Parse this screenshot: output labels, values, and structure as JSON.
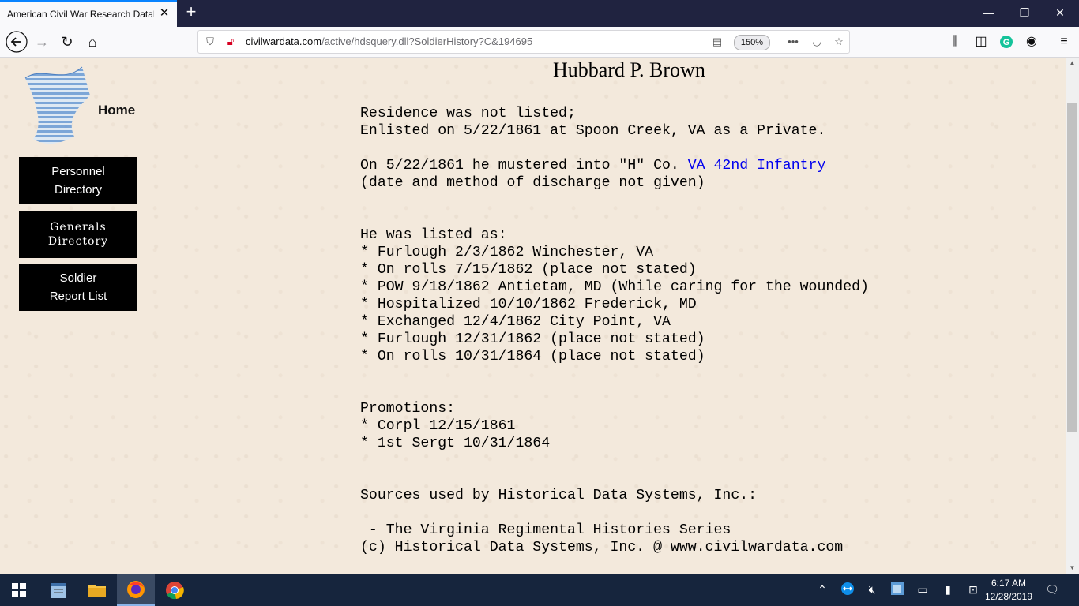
{
  "browser": {
    "tab_title": "American Civil War Research Datab",
    "url_domain": "civilwardata.com",
    "url_path": "/active/hdsquery.dll?SoldierHistory?C&194695",
    "zoom": "150%"
  },
  "sidebar": {
    "home_label": "Home",
    "buttons": [
      {
        "label": "Personnel\nDirectory"
      },
      {
        "label": "Generals\nDirectory"
      },
      {
        "label": "Soldier\nReport List"
      }
    ]
  },
  "soldier": {
    "name": "Hubbard P. Brown",
    "residence_line": "Residence was not listed;",
    "enlisted_line": "Enlisted on 5/22/1861 at Spoon Creek, VA as a Private.",
    "muster_prefix": "On 5/22/1861 he mustered into \"H\" Co. ",
    "unit_link": "VA 42nd Infantry ",
    "discharge_line": "(date and method of discharge not given)",
    "listed_heading": "He was listed as:",
    "listings": [
      "* Furlough 2/3/1862 Winchester, VA",
      "* On rolls 7/15/1862 (place not stated)",
      "* POW 9/18/1862 Antietam, MD (While caring for the wounded)",
      "* Hospitalized 10/10/1862 Frederick, MD",
      "* Exchanged 12/4/1862 City Point, VA",
      "* Furlough 12/31/1862 (place not stated)",
      "* On rolls 10/31/1864 (place not stated)"
    ],
    "promotions_heading": "Promotions:",
    "promotions": [
      "* Corpl 12/15/1861",
      "* 1st Sergt 10/31/1864"
    ],
    "sources_heading": "Sources used by Historical Data Systems, Inc.:",
    "source": " - The Virginia Regimental Histories Series",
    "copyright": "(c) Historical Data Systems, Inc. @ www.civilwardata.com"
  },
  "taskbar": {
    "time": "6:17 AM",
    "date": "12/28/2019"
  }
}
